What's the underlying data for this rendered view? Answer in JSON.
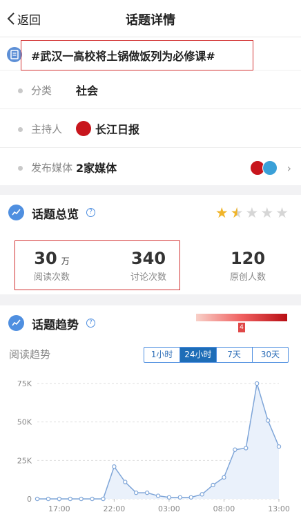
{
  "nav": {
    "back_label": "返回",
    "title": "话题详情"
  },
  "topic": {
    "title": "#武汉一高校将土锅做饭列为必修课#"
  },
  "info": {
    "category_label": "分类",
    "category_value": "社会",
    "host_label": "主持人",
    "host_value": "长江日报",
    "media_label": "发布媒体",
    "media_value": "2家媒体"
  },
  "overview": {
    "title": "话题总览",
    "rating_stars": 1.5,
    "reads_value": "30",
    "reads_unit": "万",
    "reads_label": "阅读次数",
    "discussions_value": "340",
    "discussions_label": "讨论次数",
    "creators_value": "120",
    "creators_label": "原创人数"
  },
  "trend": {
    "title": "话题趋势",
    "heat_level": "4",
    "subtitle": "阅读趋势",
    "ranges": [
      "1小时",
      "24小时",
      "7天",
      "30天"
    ],
    "active_range": "24小时"
  },
  "colors": {
    "accent": "#1e6db7",
    "line": "#7ea5d8",
    "highlight_box": "#d23030",
    "heat": "#c8161d"
  },
  "chart_data": {
    "type": "area",
    "x": [
      "15:00",
      "16:00",
      "17:00",
      "18:00",
      "19:00",
      "20:00",
      "21:00",
      "22:00",
      "23:00",
      "00:00",
      "01:00",
      "02:00",
      "03:00",
      "04:00",
      "05:00",
      "06:00",
      "07:00",
      "08:00",
      "09:00",
      "10:00",
      "11:00",
      "12:00",
      "13:00"
    ],
    "values": [
      0,
      0,
      0,
      0,
      0,
      0,
      0,
      21000,
      11000,
      4000,
      4000,
      2000,
      1000,
      1000,
      1000,
      3000,
      9000,
      14000,
      32000,
      33000,
      75000,
      51000,
      34000
    ],
    "x_ticks": [
      "17:00",
      "22:00",
      "03:00",
      "08:00",
      "13:00"
    ],
    "y_ticks": [
      "0",
      "25K",
      "50K",
      "75K"
    ],
    "ylim": [
      0,
      75000
    ]
  }
}
